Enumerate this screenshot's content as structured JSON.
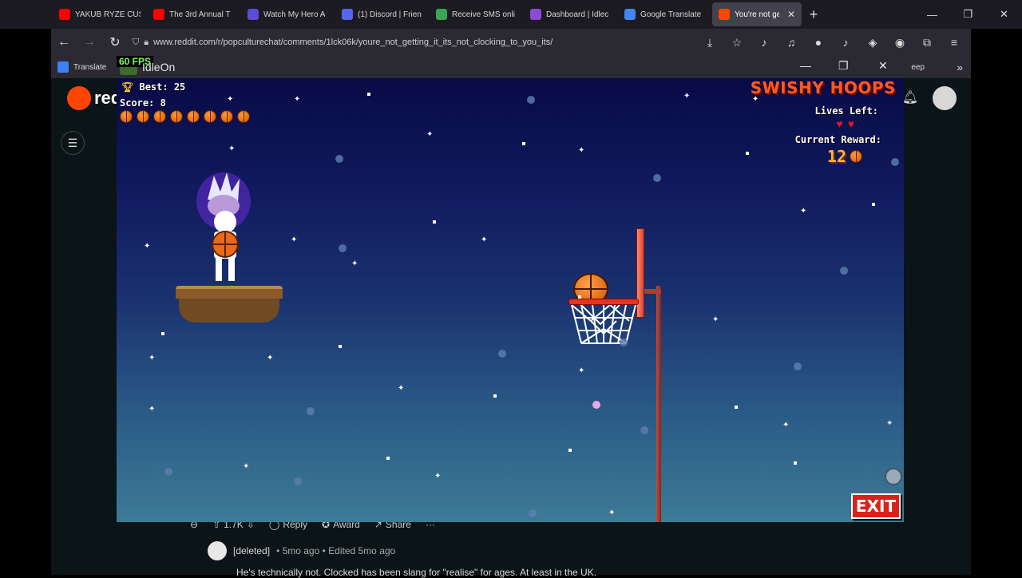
{
  "browser": {
    "tabs": [
      {
        "label": "YAKUB RYZE CUS",
        "color": "#ff0000"
      },
      {
        "label": "The 3rd Annual T",
        "color": "#ff0000"
      },
      {
        "label": "Watch My Hero A",
        "color": "#5b4bd6"
      },
      {
        "label": "(1) Discord | Frien",
        "color": "#5865f2"
      },
      {
        "label": "Receive SMS onli",
        "color": "#3aa655"
      },
      {
        "label": "Dashboard | Idlec",
        "color": "#8a4bd6"
      },
      {
        "label": "Google Translate",
        "color": "#4285f4"
      },
      {
        "label": "You're not ge",
        "color": "#ff4500",
        "active": true
      }
    ],
    "url": "www.reddit.com/r/popculturechat/comments/1lck06k/youre_not_getting_it_its_not_clocking_to_you_its/",
    "bookmark_translate": "Translate",
    "bookmark_right": "eep"
  },
  "reddit": {
    "logo_text": "red",
    "comment_actions": {
      "votes": "1.7K",
      "reply": "Reply",
      "award": "Award",
      "share": "Share",
      "more": "···"
    },
    "comment": {
      "author": "[deleted]",
      "time": "• 5mo ago • Edited 5mo ago",
      "text": "He's technically not. Clocked has been slang for \"realise\" for ages. At least in the UK."
    }
  },
  "game_window": {
    "fps": "60 FPS",
    "title": "IdleOn",
    "minimize": "—",
    "maximize": "❐",
    "close": "✕"
  },
  "game": {
    "name": "SWISHY HOOPS",
    "best": "Best: 25",
    "score": "Score: 8",
    "balls_remaining": 8,
    "lives_label": "Lives Left:",
    "lives": 2,
    "reward_label": "Current Reward:",
    "reward_value": "12",
    "exit_label": "EXIT"
  }
}
